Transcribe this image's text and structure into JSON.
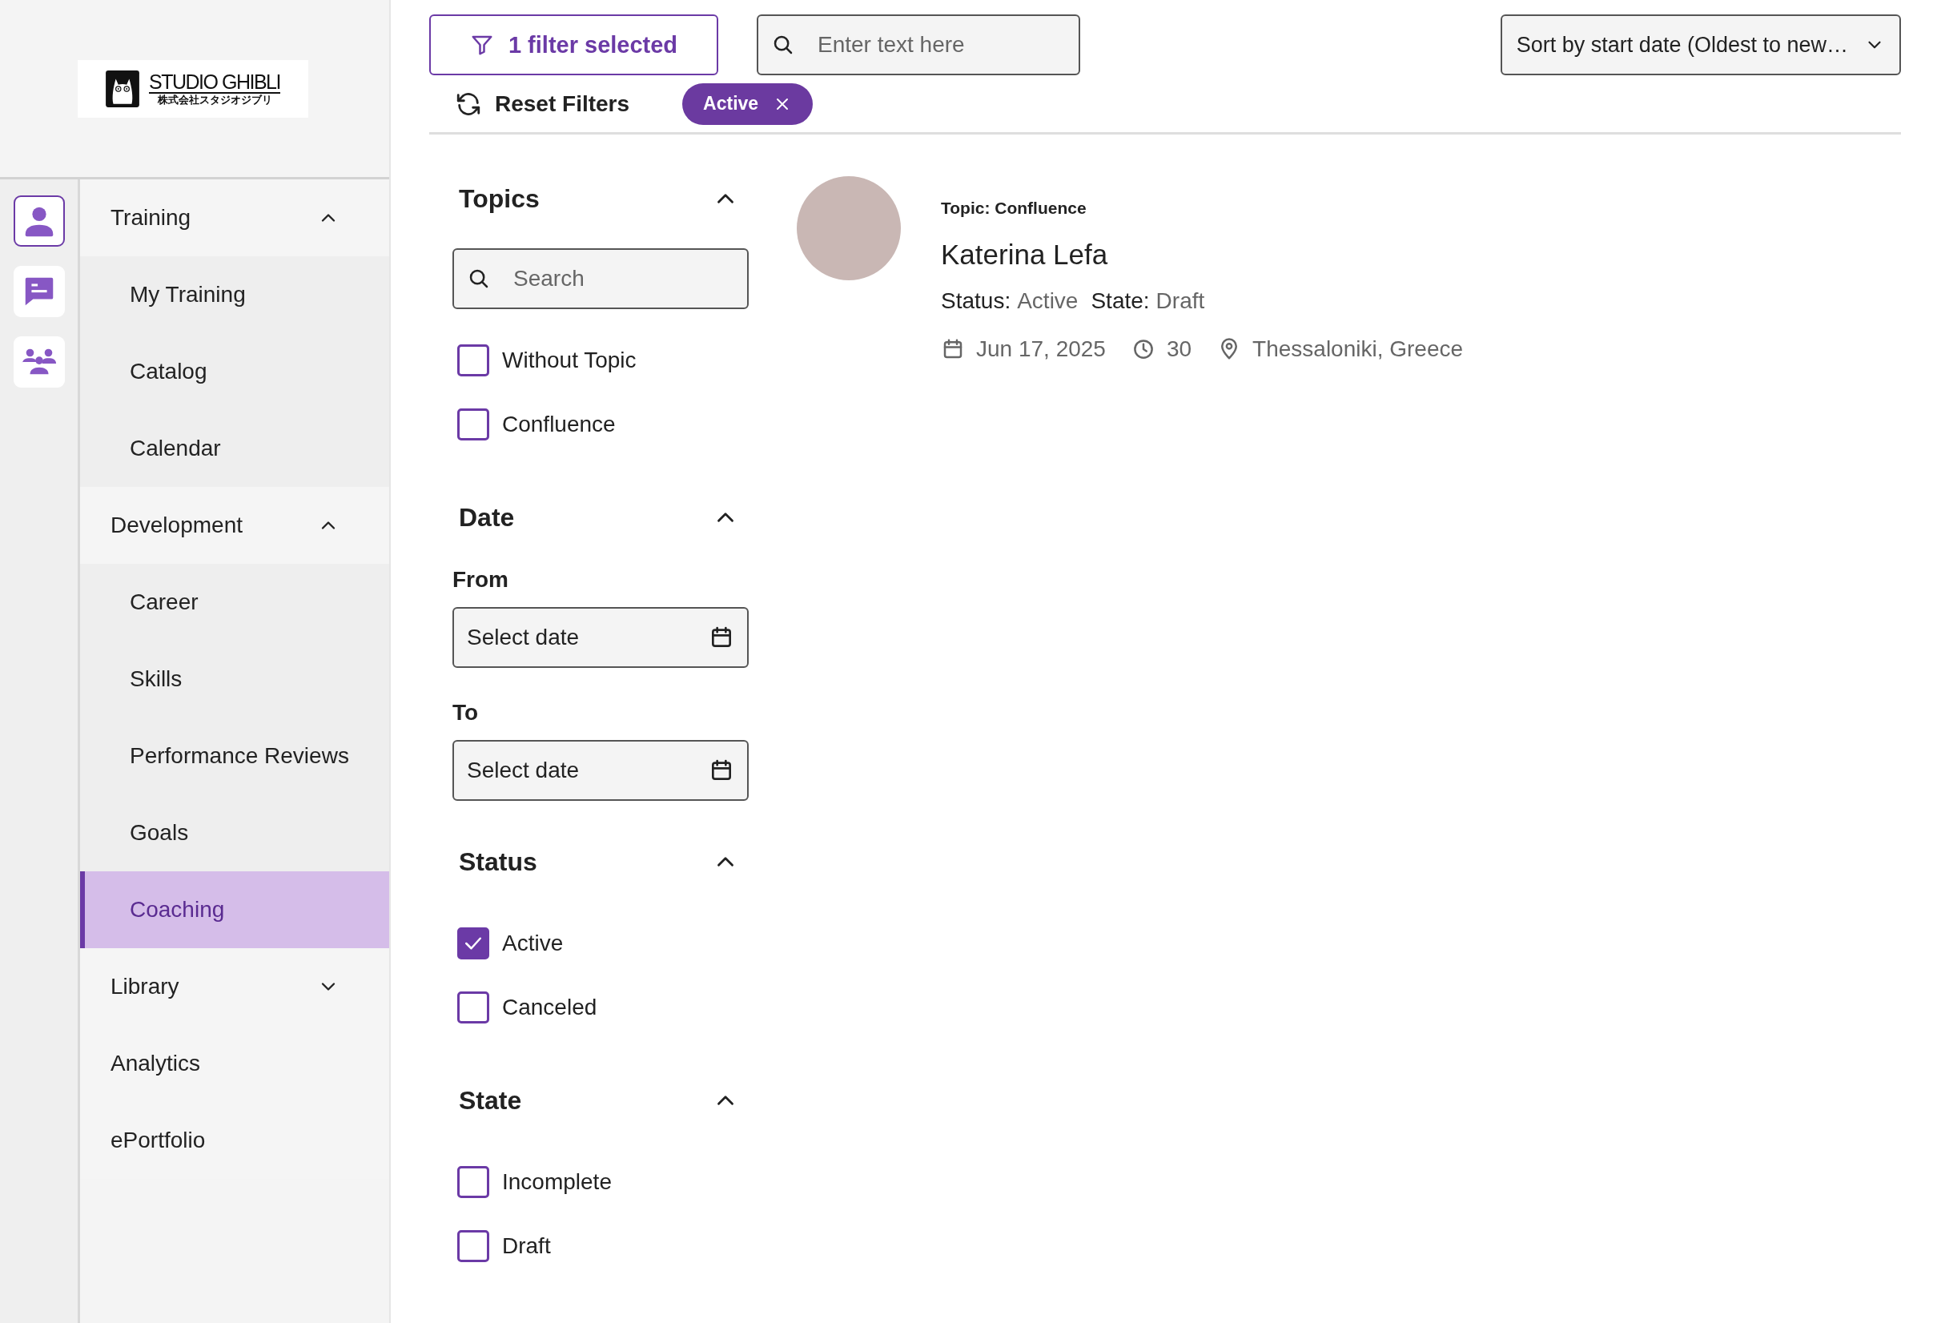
{
  "logo": {
    "name": "STUDIO GHIBLI",
    "subtitle": "株式会社スタジオジブリ"
  },
  "rail": [
    {
      "kind": "person",
      "selected": true
    },
    {
      "kind": "chat",
      "selected": false
    },
    {
      "kind": "group",
      "selected": false
    }
  ],
  "nav": [
    {
      "label": "Training",
      "expanded": true,
      "selected": false,
      "children": [
        {
          "label": "My Training",
          "selected": false
        },
        {
          "label": "Catalog",
          "selected": false
        },
        {
          "label": "Calendar",
          "selected": false
        }
      ]
    },
    {
      "label": "Development",
      "expanded": true,
      "selected": false,
      "children": [
        {
          "label": "Career",
          "selected": false
        },
        {
          "label": "Skills",
          "selected": false
        },
        {
          "label": "Performance Reviews",
          "selected": false
        },
        {
          "label": "Goals",
          "selected": false
        },
        {
          "label": "Coaching",
          "selected": true
        }
      ]
    },
    {
      "label": "Library",
      "expanded": false,
      "selected": false
    },
    {
      "label": "Analytics",
      "selected": false
    },
    {
      "label": "ePortfolio",
      "selected": false
    }
  ],
  "toolbar": {
    "filter_button": "1 filter selected",
    "search": {
      "placeholder": "Enter text here"
    },
    "sort": {
      "value": "Sort by start date (Oldest to new…"
    },
    "reset": "Reset Filters",
    "chips": [
      {
        "label": "Active"
      }
    ]
  },
  "filters": [
    {
      "kind": "checklist",
      "title": "Topics",
      "expanded": true,
      "search": {
        "placeholder": "Search"
      },
      "options": [
        {
          "label": "Without Topic",
          "checked": false
        },
        {
          "label": "Confluence",
          "checked": false
        }
      ]
    },
    {
      "kind": "dates",
      "title": "Date",
      "expanded": true,
      "fields": [
        {
          "label": "From",
          "placeholder": "Select date"
        },
        {
          "label": "To",
          "placeholder": "Select date"
        }
      ]
    },
    {
      "kind": "checklist",
      "title": "Status",
      "expanded": true,
      "options": [
        {
          "label": "Active",
          "checked": true
        },
        {
          "label": "Canceled",
          "checked": false
        }
      ]
    },
    {
      "kind": "checklist",
      "title": "State",
      "expanded": true,
      "options": [
        {
          "label": "Incomplete",
          "checked": false
        },
        {
          "label": "Draft",
          "checked": false
        }
      ]
    }
  ],
  "results": [
    {
      "topic": "Topic: Confluence",
      "name": "Katerina Lefa",
      "status_label": "Status:",
      "status": "Active",
      "state_label": "State:",
      "state": "Draft",
      "date": "Jun 17, 2025",
      "duration": "30",
      "location": "Thessaloniki, Greece"
    }
  ]
}
